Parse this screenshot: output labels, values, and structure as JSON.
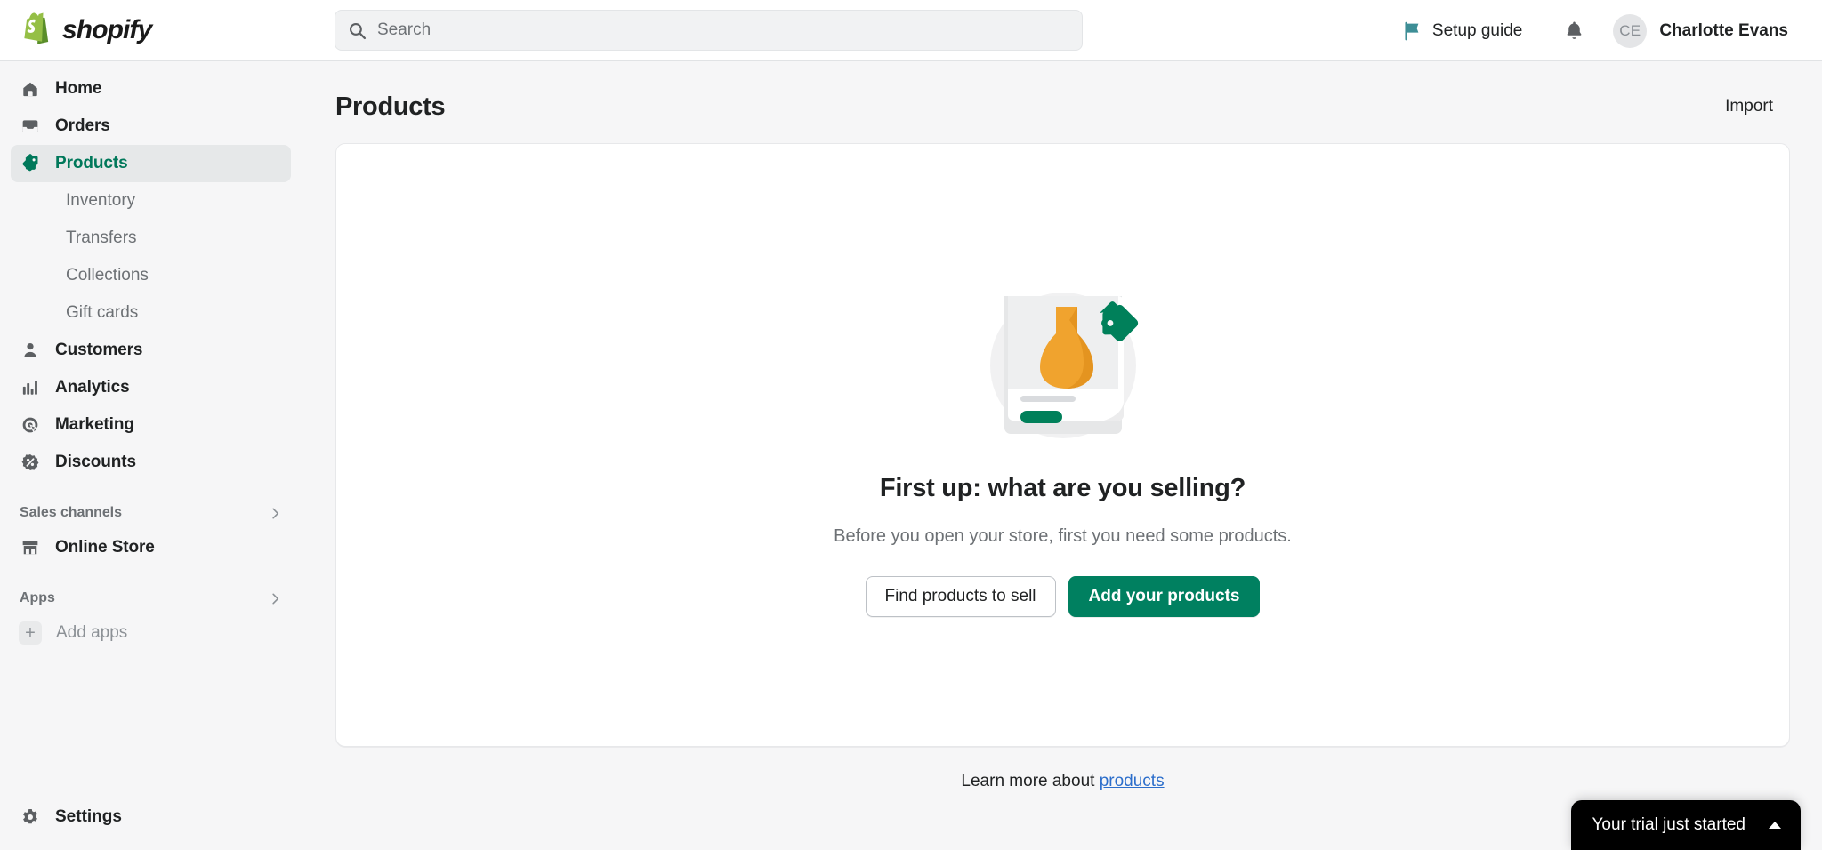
{
  "topbar": {
    "logo_text": "shopify",
    "logo_icon": "shopify-bag-icon",
    "search": {
      "placeholder": "Search",
      "value": "",
      "icon": "search-icon"
    },
    "setup_guide": {
      "label": "Setup guide",
      "icon": "flag-icon",
      "icon_color": "#3d8e96"
    },
    "notifications_icon": "bell-icon",
    "user": {
      "initials": "CE",
      "name": "Charlotte Evans"
    }
  },
  "sidebar": {
    "items": [
      {
        "label": "Home",
        "icon": "home-icon",
        "active": false
      },
      {
        "label": "Orders",
        "icon": "orders-inbox-icon",
        "active": false
      },
      {
        "label": "Products",
        "icon": "product-tag-icon",
        "active": true
      },
      {
        "label": "Customers",
        "icon": "person-icon",
        "active": false
      },
      {
        "label": "Analytics",
        "icon": "bar-chart-icon",
        "active": false
      },
      {
        "label": "Marketing",
        "icon": "megaphone-target-icon",
        "active": false
      },
      {
        "label": "Discounts",
        "icon": "discount-percent-icon",
        "active": false
      }
    ],
    "product_subitems": [
      {
        "label": "Inventory"
      },
      {
        "label": "Transfers"
      },
      {
        "label": "Collections"
      },
      {
        "label": "Gift cards"
      }
    ],
    "sales_channels": {
      "title": "Sales channels",
      "chevron": "chevron-right-icon",
      "items": [
        {
          "label": "Online Store",
          "icon": "storefront-icon"
        }
      ]
    },
    "apps": {
      "title": "Apps",
      "chevron": "chevron-right-icon",
      "add_label": "Add apps",
      "add_icon": "plus-icon"
    },
    "settings": {
      "label": "Settings",
      "icon": "gear-icon"
    },
    "active_accent": "#00785a",
    "active_bg": "#e6e8e9"
  },
  "main": {
    "page_title": "Products",
    "import_label": "Import",
    "empty_state": {
      "illustration": "product-card-vase-tag-illustration",
      "title": "First up: what are you selling?",
      "subtitle": "Before you open your store, first you need some products.",
      "secondary_button": "Find products to sell",
      "primary_button": "Add your products",
      "primary_color": "#008060"
    },
    "footer": {
      "text_before": "Learn more about",
      "link_text": "products",
      "link_color": "#2c6ecb"
    }
  },
  "trial_toast": {
    "label": "Your trial just started",
    "caret_icon": "caret-up-icon",
    "background": "#000000"
  }
}
